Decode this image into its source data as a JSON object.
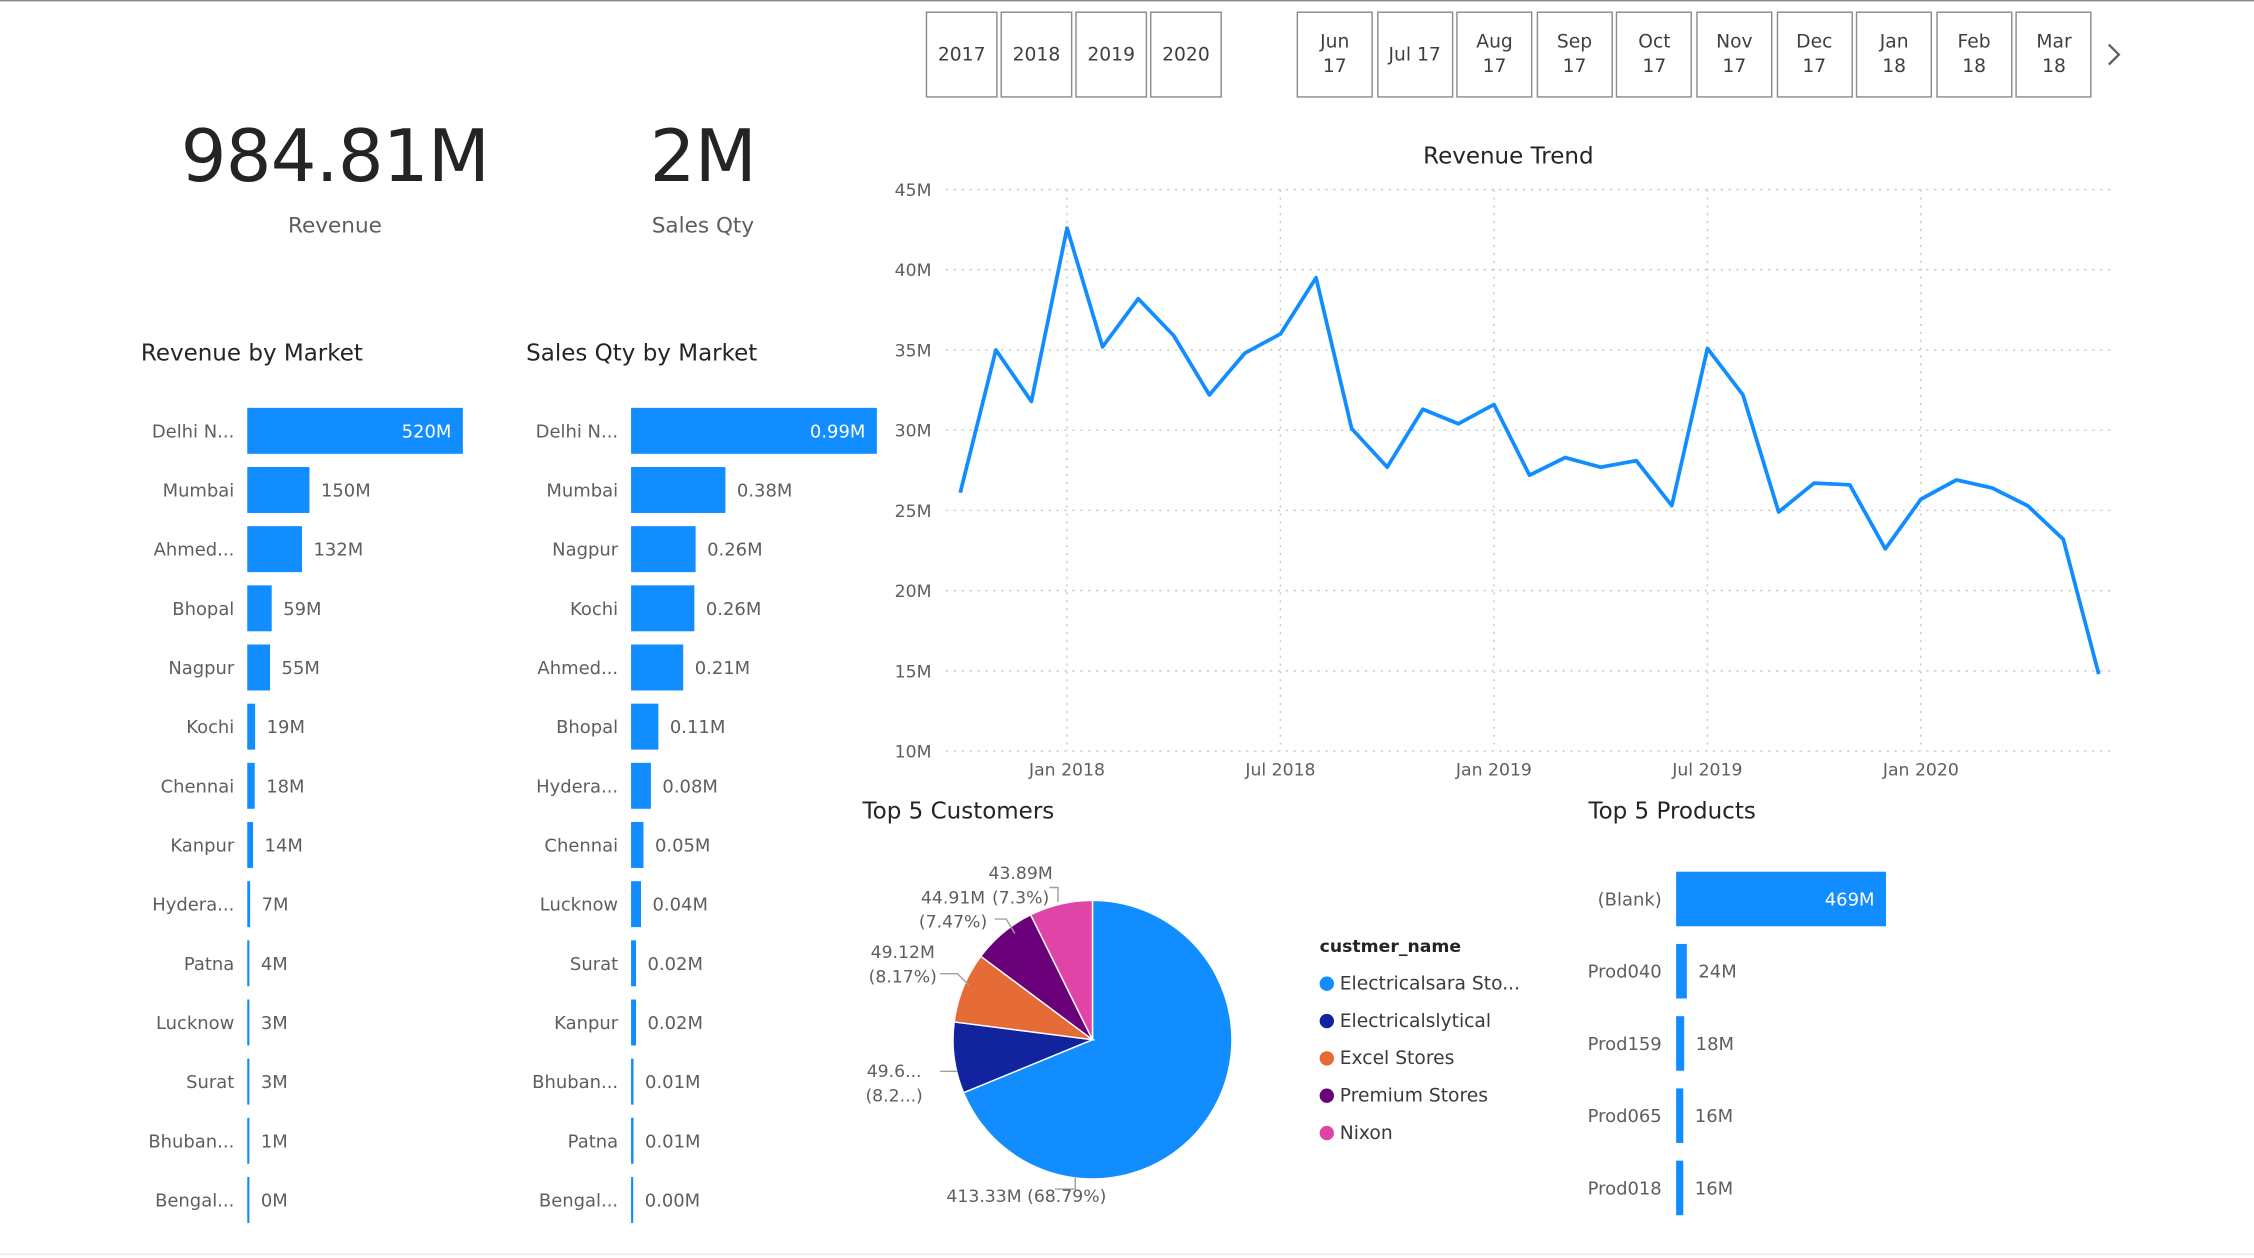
{
  "colors": {
    "bar": "#118DFF",
    "line": "#118DFF",
    "grid": "#c8c8c8",
    "pie": [
      "#118DFF",
      "#12239E",
      "#E66C37",
      "#6B007B",
      "#E044A7"
    ]
  },
  "year_slicer": [
    "2017",
    "2018",
    "2019",
    "2020"
  ],
  "month_slicer": [
    "Jun\n17",
    "Jul 17",
    "Aug\n17",
    "Sep\n17",
    "Oct\n17",
    "Nov\n17",
    "Dec\n17",
    "Jan\n18",
    "Feb\n18",
    "Mar\n18"
  ],
  "month_slicer_next_icon": "chevron-right-icon",
  "kpis": {
    "revenue": {
      "value": "984.81M",
      "label": "Revenue"
    },
    "sales_qty": {
      "value": "2M",
      "label": "Sales Qty"
    }
  },
  "revenue_by_market": {
    "title": "Revenue by Market",
    "rows": [
      {
        "label": "Delhi N...",
        "value": 520,
        "text": "520M"
      },
      {
        "label": "Mumbai",
        "value": 150,
        "text": "150M"
      },
      {
        "label": "Ahmed...",
        "value": 132,
        "text": "132M"
      },
      {
        "label": "Bhopal",
        "value": 59,
        "text": "59M"
      },
      {
        "label": "Nagpur",
        "value": 55,
        "text": "55M"
      },
      {
        "label": "Kochi",
        "value": 19,
        "text": "19M"
      },
      {
        "label": "Chennai",
        "value": 18,
        "text": "18M"
      },
      {
        "label": "Kanpur",
        "value": 14,
        "text": "14M"
      },
      {
        "label": "Hydera...",
        "value": 7,
        "text": "7M"
      },
      {
        "label": "Patna",
        "value": 4,
        "text": "4M"
      },
      {
        "label": "Lucknow",
        "value": 3,
        "text": "3M"
      },
      {
        "label": "Surat",
        "value": 3,
        "text": "3M"
      },
      {
        "label": "Bhuban...",
        "value": 1,
        "text": "1M"
      },
      {
        "label": "Bengal...",
        "value": 0.3,
        "text": "0M"
      }
    ]
  },
  "sales_qty_by_market": {
    "title": "Sales Qty by Market",
    "rows": [
      {
        "label": "Delhi N...",
        "value": 0.99,
        "text": "0.99M"
      },
      {
        "label": "Mumbai",
        "value": 0.38,
        "text": "0.38M"
      },
      {
        "label": "Nagpur",
        "value": 0.26,
        "text": "0.26M"
      },
      {
        "label": "Kochi",
        "value": 0.255,
        "text": "0.26M"
      },
      {
        "label": "Ahmed...",
        "value": 0.21,
        "text": "0.21M"
      },
      {
        "label": "Bhopal",
        "value": 0.11,
        "text": "0.11M"
      },
      {
        "label": "Hydera...",
        "value": 0.08,
        "text": "0.08M"
      },
      {
        "label": "Chennai",
        "value": 0.05,
        "text": "0.05M"
      },
      {
        "label": "Lucknow",
        "value": 0.04,
        "text": "0.04M"
      },
      {
        "label": "Surat",
        "value": 0.02,
        "text": "0.02M"
      },
      {
        "label": "Kanpur",
        "value": 0.02,
        "text": "0.02M"
      },
      {
        "label": "Bhuban...",
        "value": 0.01,
        "text": "0.01M"
      },
      {
        "label": "Patna",
        "value": 0.01,
        "text": "0.01M"
      },
      {
        "label": "Bengal...",
        "value": 0.002,
        "text": "0.00M"
      }
    ]
  },
  "revenue_trend": {
    "title": "Revenue Trend",
    "chart_data": {
      "type": "line",
      "y_ticks": [
        "45M",
        "40M",
        "35M",
        "30M",
        "25M",
        "20M",
        "15M",
        "10M"
      ],
      "ylim": [
        10,
        45
      ],
      "x_ticks": [
        {
          "label": "Jan 2018",
          "index": 3
        },
        {
          "label": "Jul 2018",
          "index": 9
        },
        {
          "label": "Jan 2019",
          "index": 15
        },
        {
          "label": "Jul 2019",
          "index": 21
        },
        {
          "label": "Jan 2020",
          "index": 27
        }
      ],
      "x": [
        "2017-10",
        "2017-11",
        "2017-12",
        "2018-01",
        "2018-02",
        "2018-03",
        "2018-04",
        "2018-05",
        "2018-06",
        "2018-07",
        "2018-08",
        "2018-09",
        "2018-10",
        "2018-11",
        "2018-12",
        "2019-01",
        "2019-02",
        "2019-03",
        "2019-04",
        "2019-05",
        "2019-06",
        "2019-07",
        "2019-08",
        "2019-09",
        "2019-10",
        "2019-11",
        "2019-12",
        "2020-01",
        "2020-02",
        "2020-03",
        "2020-04",
        "2020-05",
        "2020-06"
      ],
      "values": [
        26.1,
        35.0,
        31.8,
        42.6,
        35.2,
        38.2,
        35.9,
        32.2,
        34.8,
        36.0,
        39.5,
        30.1,
        27.7,
        31.3,
        30.4,
        31.6,
        27.2,
        28.3,
        27.7,
        28.1,
        25.3,
        35.1,
        32.2,
        24.9,
        26.7,
        26.6,
        22.6,
        25.7,
        26.9,
        26.4,
        25.3,
        23.2,
        14.8
      ]
    }
  },
  "top_customers": {
    "title": "Top 5 Customers",
    "legend_title": "custmer_name",
    "chart_data": {
      "type": "pie",
      "slices": [
        {
          "name": "Electricalsara Sto...",
          "value": 413.33,
          "label_lines": [
            "413.33M (68.79%)"
          ]
        },
        {
          "name": "Electricalslytical",
          "value": 49.6,
          "label_lines": [
            "49.6...",
            "(8.2...)"
          ]
        },
        {
          "name": "Excel Stores",
          "value": 49.12,
          "label_lines": [
            "49.12M",
            "(8.17%)"
          ]
        },
        {
          "name": "Premium Stores",
          "value": 44.91,
          "label_lines": [
            "44.91M",
            "(7.47%)"
          ]
        },
        {
          "name": "Nixon",
          "value": 43.89,
          "label_lines": [
            "43.89M",
            "(7.3%)"
          ]
        }
      ]
    }
  },
  "top_products": {
    "title": "Top 5 Products",
    "rows": [
      {
        "label": "(Blank)",
        "value": 469,
        "text": "469M"
      },
      {
        "label": "Prod040",
        "value": 24,
        "text": "24M"
      },
      {
        "label": "Prod159",
        "value": 18,
        "text": "18M"
      },
      {
        "label": "Prod065",
        "value": 16,
        "text": "16M"
      },
      {
        "label": "Prod018",
        "value": 16,
        "text": "16M"
      }
    ]
  }
}
